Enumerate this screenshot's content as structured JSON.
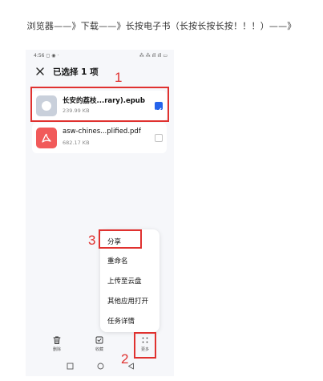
{
  "caption": "浏览器——》下载——》长按电子书（长按长按长按！！！）——》",
  "statusbar": {
    "left": "4:56 ◻ ◉ ·",
    "right": "⁂ ⁂ ıll ıll ▭"
  },
  "header": {
    "title": "已选择 1 项"
  },
  "files": [
    {
      "name": "长安的荔枝...rary).epub",
      "size": "239.99 KB",
      "selected": true
    },
    {
      "name": "asw-chines...plified.pdf",
      "size": "682.17 KB",
      "selected": false
    }
  ],
  "menu": {
    "items": [
      "分享",
      "重命名",
      "上传至云盘",
      "其他应用打开",
      "任务详情"
    ]
  },
  "actions": {
    "delete": "删除",
    "favorite": "收藏",
    "more": "更多"
  },
  "annotations": {
    "n1": "1",
    "n2": "2",
    "n3": "3"
  },
  "colors": {
    "annotation": "#e0312f",
    "accent": "#2563eb",
    "pdf": "#f15a5a"
  }
}
